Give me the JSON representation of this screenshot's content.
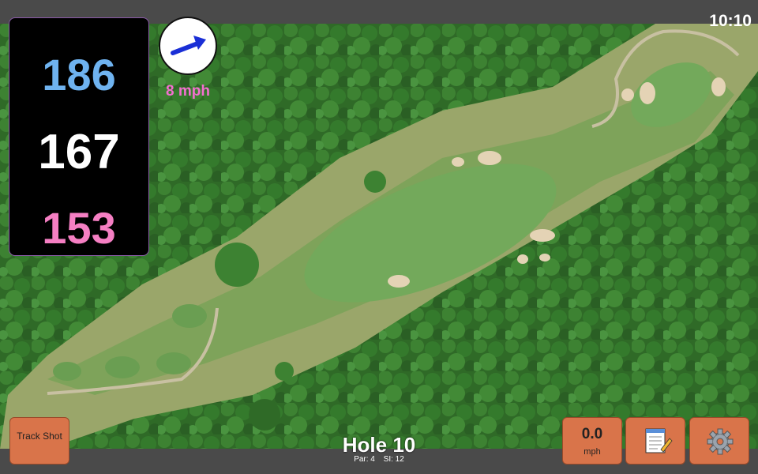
{
  "clock": "10:10",
  "yardage": {
    "back": "186",
    "middle": "167",
    "front": "153"
  },
  "wind": {
    "speed_label": "8 mph",
    "direction_icon": "wind-arrow-icon"
  },
  "buttons": {
    "track_shot": "Track Shot",
    "speed_value": "0.0",
    "speed_unit": "mph",
    "notes_icon": "notepad-icon",
    "settings_icon": "gear-icon"
  },
  "hole": {
    "title": "Hole 10",
    "par": "Par: 4",
    "si": "SI: 12"
  },
  "colors": {
    "back": "#6fb3f0",
    "middle": "#ffffff",
    "front": "#f57fc3",
    "wind_text": "#f36fd0",
    "button": "#d9744a"
  }
}
